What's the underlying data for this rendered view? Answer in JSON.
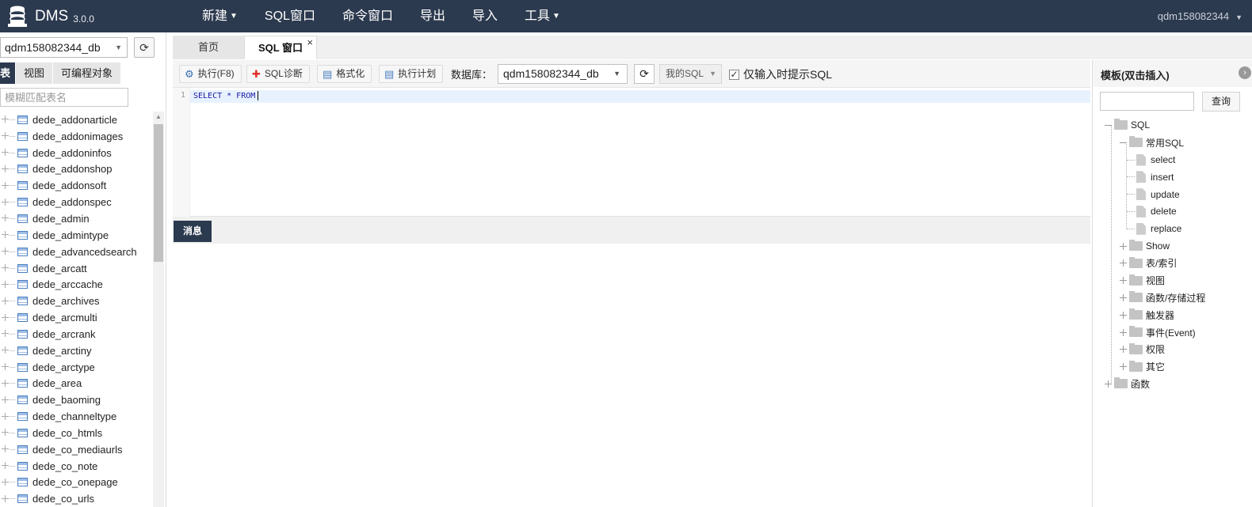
{
  "topbar": {
    "brand": "DMS",
    "version": "3.0.0",
    "nav": [
      {
        "label": "新建",
        "caret": true
      },
      {
        "label": "SQL窗口",
        "caret": false
      },
      {
        "label": "命令窗口",
        "caret": false
      },
      {
        "label": "导出",
        "caret": false
      },
      {
        "label": "导入",
        "caret": false
      },
      {
        "label": "工具",
        "caret": true
      }
    ],
    "user": "qdm158082344"
  },
  "sidebar": {
    "database": "qdm158082344_db",
    "tabs": [
      "表",
      "视图",
      "可编程对象"
    ],
    "filter_placeholder": "模糊匹配表名",
    "tables": [
      "dede_addonarticle",
      "dede_addonimages",
      "dede_addoninfos",
      "dede_addonshop",
      "dede_addonsoft",
      "dede_addonspec",
      "dede_admin",
      "dede_admintype",
      "dede_advancedsearch",
      "dede_arcatt",
      "dede_arccache",
      "dede_archives",
      "dede_arcmulti",
      "dede_arcrank",
      "dede_arctiny",
      "dede_arctype",
      "dede_area",
      "dede_baoming",
      "dede_channeltype",
      "dede_co_htmls",
      "dede_co_mediaurls",
      "dede_co_note",
      "dede_co_onepage",
      "dede_co_urls"
    ]
  },
  "tabs": {
    "home": "首页",
    "sql": "SQL 窗口",
    "close": "×"
  },
  "toolbar": {
    "execute": "执行(F8)",
    "diagnose": "SQL诊断",
    "format": "格式化",
    "plan": "执行计划",
    "db_label": "数据库：",
    "db_value": "qdm158082344_db",
    "my_sql": "我的SQL",
    "hint_label": "仅输入时提示SQL",
    "hint_checked": true
  },
  "editor": {
    "line_number": "1",
    "code": "SELECT * FROM"
  },
  "messages": {
    "tab": "消息"
  },
  "templates": {
    "title": "模板(双击插入)",
    "search_button": "查询",
    "root": "SQL",
    "common": "常用SQL",
    "common_items": [
      "select",
      "insert",
      "update",
      "delete",
      "replace"
    ],
    "groups": [
      "Show",
      "表/索引",
      "视图",
      "函数/存储过程",
      "触发器",
      "事件(Event)",
      "权限",
      "其它"
    ],
    "functions": "函数"
  }
}
